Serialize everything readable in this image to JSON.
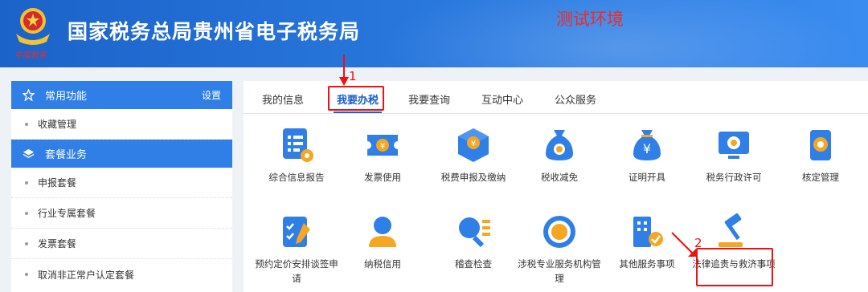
{
  "header": {
    "site_title": "国家税务总局贵州省电子税务局",
    "env_label": "测试环境",
    "emblem_script": "中国税务"
  },
  "sidebar": {
    "sections": [
      {
        "title": "常用功能",
        "icon": "star-icon",
        "action": "设置"
      },
      {
        "title": "套餐业务",
        "icon": "layers-icon"
      }
    ],
    "items_favorites": [
      "收藏管理"
    ],
    "items_packages": [
      "申报套餐",
      "行业专属套餐",
      "发票套餐",
      "取消非正常户认定套餐"
    ]
  },
  "tabs": [
    "我的信息",
    "我要办税",
    "我要查询",
    "互动中心",
    "公众服务"
  ],
  "active_tab": "我要办税",
  "services_row1": [
    {
      "label": "综合信息报告",
      "icon": "report-gear-icon"
    },
    {
      "label": "发票使用",
      "icon": "ticket-icon"
    },
    {
      "label": "税费申报及缴纳",
      "icon": "box-yuan-icon"
    },
    {
      "label": "税收减免",
      "icon": "money-bag-search-icon"
    },
    {
      "label": "证明开具",
      "icon": "money-bag-yuan-icon"
    },
    {
      "label": "税务行政许可",
      "icon": "monitor-search-icon"
    },
    {
      "label": "核定管理",
      "icon": "clipboard-gear-icon"
    }
  ],
  "services_row2": [
    {
      "label": "预约定价安排谈签申请",
      "icon": "checklist-pen-icon"
    },
    {
      "label": "纳税信用",
      "icon": "user-icon"
    },
    {
      "label": "稽查检查",
      "icon": "search-list-icon"
    },
    {
      "label": "涉税专业服务机构管理",
      "icon": "seal-icon"
    },
    {
      "label": "其他服务事项",
      "icon": "building-check-icon"
    },
    {
      "label": "法律追责与救济事项",
      "icon": "gavel-icon"
    }
  ],
  "annotations": {
    "step1": "1",
    "step2": "2"
  },
  "colors": {
    "brand_blue": "#2f7fe6",
    "header_blue": "#1b63c9",
    "annotation_red": "#e11111",
    "env_red": "#f02a2a"
  }
}
